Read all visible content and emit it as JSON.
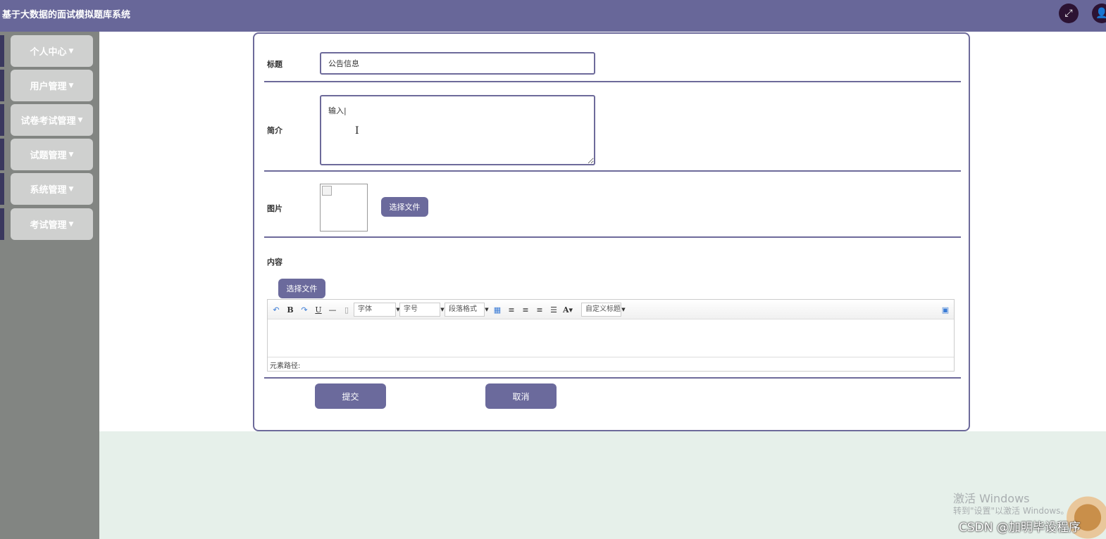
{
  "header": {
    "title": "基于大数据的面试模拟题库系统"
  },
  "sidebar": {
    "items": [
      {
        "label": "个人中心"
      },
      {
        "label": "用户管理"
      },
      {
        "label": "试卷考试管理"
      },
      {
        "label": "试题管理"
      },
      {
        "label": "系统管理"
      },
      {
        "label": "考试管理"
      }
    ]
  },
  "form": {
    "title_label": "标题",
    "title_value": "公告信息",
    "intro_label": "简介",
    "intro_value": "输入|",
    "image_label": "图片",
    "choose_file_label": "选择文件",
    "content_label": "内容",
    "content_choose_file_label": "选择文件",
    "submit_label": "提交",
    "cancel_label": "取消"
  },
  "editor": {
    "font_select": "字体",
    "size_select": "字号",
    "paragraph_select": "段落格式",
    "custom_title_select": "自定义标题",
    "path_label": "元素路径:"
  },
  "watermark": {
    "line1": "激活 Windows",
    "line2": "转到\"设置\"以激活 Windows。",
    "csdn": "CSDN @加明毕设程序"
  },
  "colors": {
    "header": "#686799",
    "accent": "#6b6a9c",
    "sidebar": "#828582",
    "background": "#e6f0ea"
  }
}
